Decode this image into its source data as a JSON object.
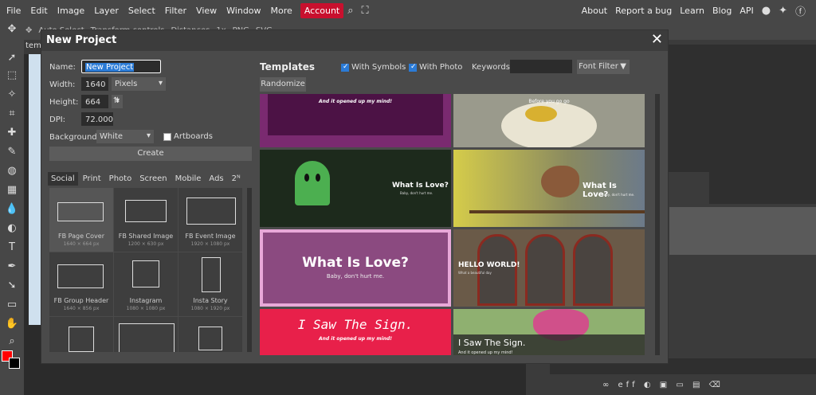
{
  "menubar": {
    "items": [
      "File",
      "Edit",
      "Image",
      "Layer",
      "Select",
      "Filter",
      "View",
      "Window",
      "More"
    ],
    "account": "Account",
    "right": [
      "About",
      "Report a bug",
      "Learn",
      "Blog",
      "API"
    ]
  },
  "optionbar": {
    "auto_select": "Auto Select",
    "transform": "Transform controls",
    "distances": "Distances",
    "zoom": "1x",
    "png": "PNG",
    "svg": "SVG"
  },
  "doc_tab": "tem",
  "modal": {
    "title": "New Project",
    "name_label": "Name:",
    "name_value": "New Project",
    "width_label": "Width:",
    "width_value": "1640",
    "unit": "Pixels",
    "height_label": "Height:",
    "height_value": "664",
    "dpi_label": "DPI:",
    "dpi_value": "72.000",
    "background_label": "Background:",
    "background_value": "White",
    "artboards": "Artboards",
    "create": "Create",
    "tabs": [
      "Social",
      "Print",
      "Photo",
      "Screen",
      "Mobile",
      "Ads",
      "2ᴺ"
    ],
    "presets": [
      {
        "name": "FB Page Cover",
        "size": "1640 × 664 px"
      },
      {
        "name": "FB Shared Image",
        "size": "1200 × 630 px"
      },
      {
        "name": "FB Event Image",
        "size": "1920 × 1080 px"
      },
      {
        "name": "FB Group Header",
        "size": "1640 × 856 px"
      },
      {
        "name": "Instagram",
        "size": "1080 × 1080 px"
      },
      {
        "name": "Insta Story",
        "size": "1080 × 1920 px"
      }
    ],
    "templates_label": "Templates",
    "with_symbols": "With Symbols",
    "with_photo": "With Photo",
    "keywords_label": "Keywords:",
    "font_filter": "Font Filter",
    "randomize": "Randomize",
    "thumbs": {
      "t1": "And it opened up my mind!",
      "t2": "Before you go go",
      "t3a": "What Is Love?",
      "t3b": "Baby, don't hurt me.",
      "t4a": "What Is Love?",
      "t4b": "Baby, don't hurt me.",
      "t5a": "What Is Love?",
      "t5b": "Baby, don't hurt me.",
      "t6a": "HELLO WORLD!",
      "t6b": "What a beautiful day",
      "t7a": "I Saw The Sign.",
      "t7b": "And it opened up my mind!",
      "t8a": "I Saw The Sign.",
      "t8b": "And it opened up my mind!"
    }
  },
  "colors": {
    "accent": "#c8102e",
    "fg": "#ff0000",
    "bg": "#000000"
  }
}
